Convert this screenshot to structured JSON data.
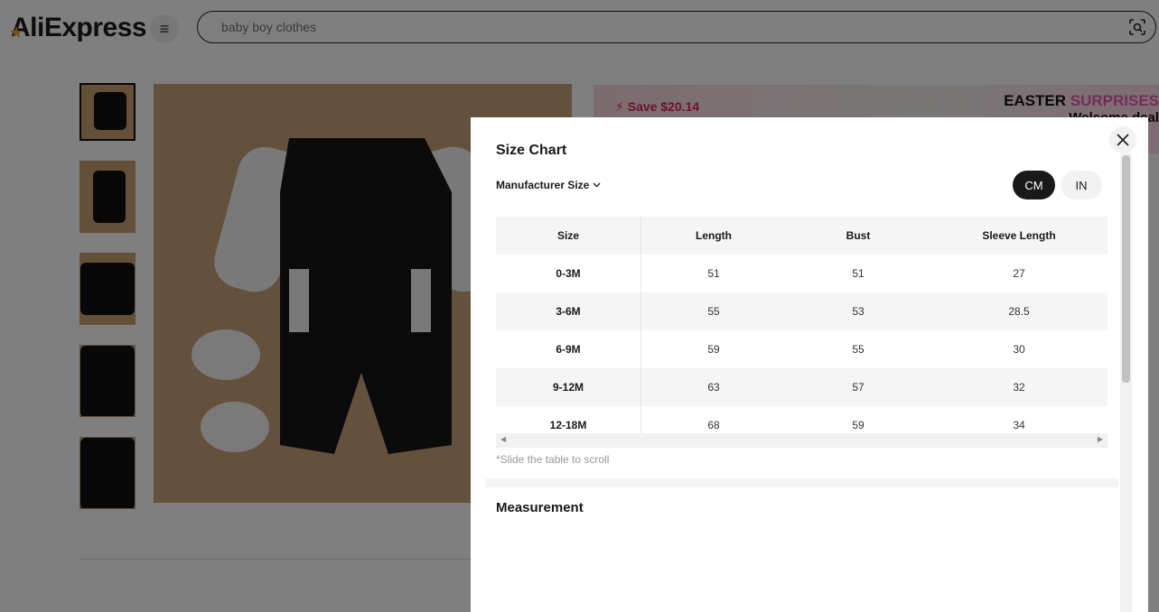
{
  "header": {
    "logo": "AliExpress",
    "search_placeholder": "baby boy clothes"
  },
  "promo": {
    "save_text": "Save $20.14",
    "easter_a": "EASTER ",
    "easter_b": "SURPRISES",
    "welcome": "Welcome deal"
  },
  "modal": {
    "title": "Size Chart",
    "manufacturer_label": "Manufacturer Size",
    "units": {
      "cm": "CM",
      "in": "IN"
    },
    "columns": [
      "Size",
      "Length",
      "Bust",
      "Sleeve Length"
    ],
    "rows": [
      [
        "0-3M",
        "51",
        "51",
        "27"
      ],
      [
        "3-6M",
        "55",
        "53",
        "28.5"
      ],
      [
        "6-9M",
        "59",
        "55",
        "30"
      ],
      [
        "9-12M",
        "63",
        "57",
        "32"
      ],
      [
        "12-18M",
        "68",
        "59",
        "34"
      ]
    ],
    "scroll_hint": "*Slide the table to scroll",
    "measurement_title": "Measurement"
  }
}
